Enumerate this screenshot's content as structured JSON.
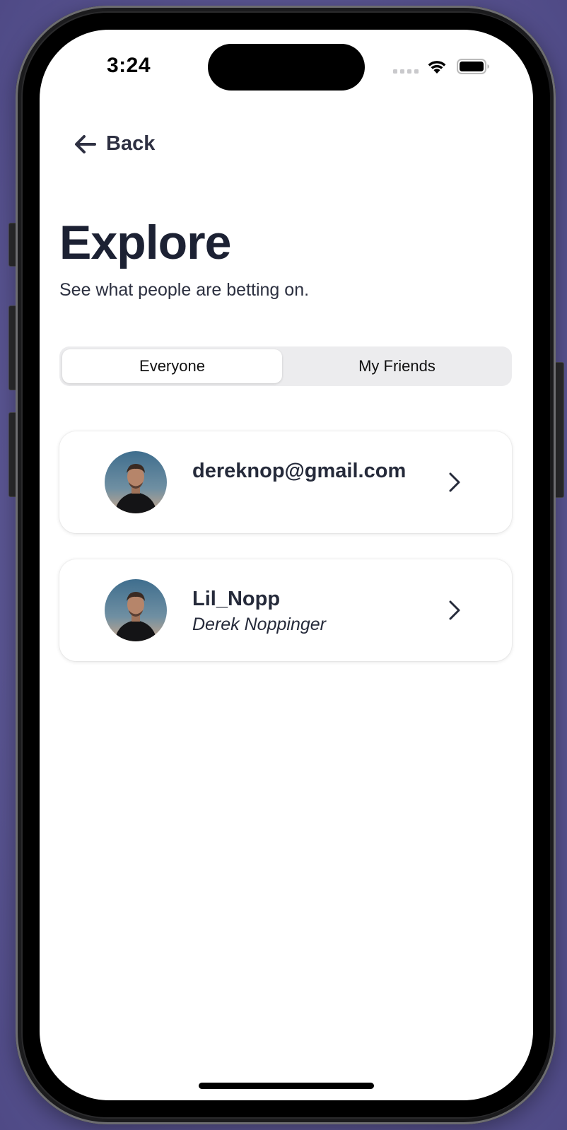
{
  "status_bar": {
    "time": "3:24"
  },
  "nav": {
    "back_label": "Back"
  },
  "header": {
    "title": "Explore",
    "subtitle": "See what people are betting on."
  },
  "tabs": [
    {
      "label": "Everyone",
      "selected": true
    },
    {
      "label": "My Friends",
      "selected": false
    }
  ],
  "users": [
    {
      "primary": "dereknop@gmail.com",
      "secondary": ""
    },
    {
      "primary": "Lil_Nopp",
      "secondary": "Derek Noppinger"
    }
  ],
  "colors": {
    "background": "#5f5a98",
    "text_primary": "#1c2133",
    "segment_track": "#ececee"
  },
  "icons": {
    "back": "arrow-left-icon",
    "chevron": "chevron-right-icon",
    "wifi": "wifi-icon",
    "battery": "battery-icon"
  }
}
